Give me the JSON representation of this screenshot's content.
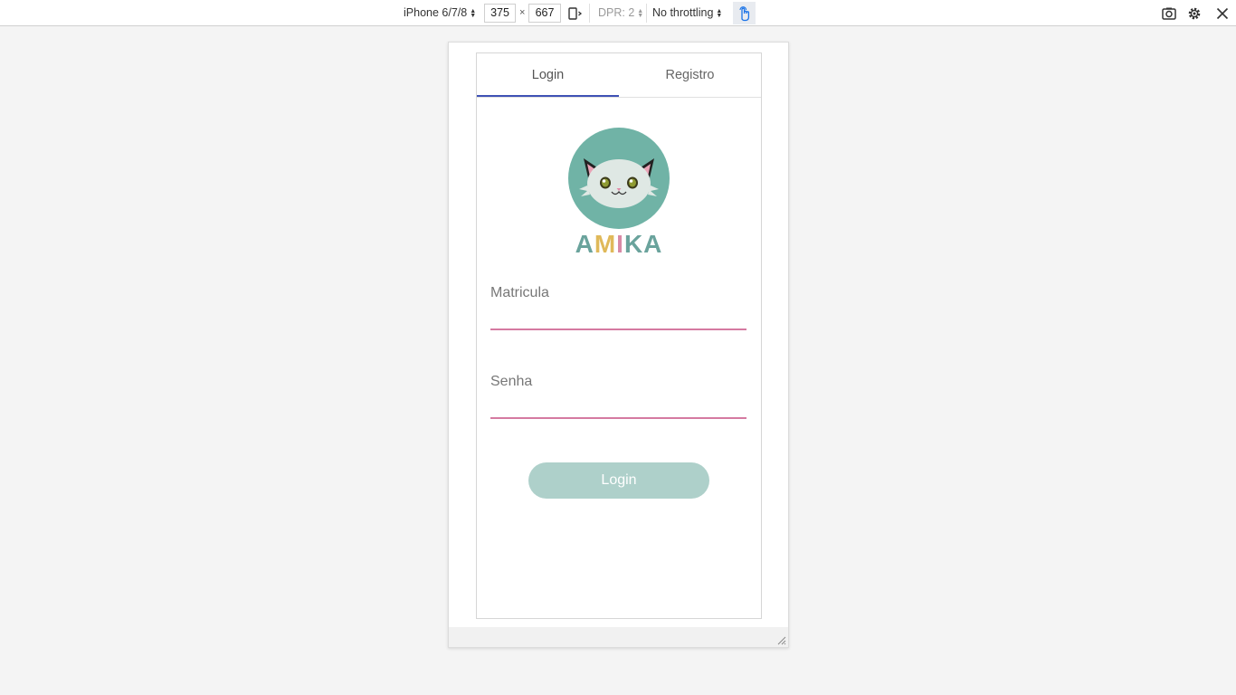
{
  "toolbar": {
    "device": "iPhone 6/7/8",
    "width": "375",
    "times": "×",
    "height": "667",
    "dpr": "DPR: 2",
    "throttling": "No throttling",
    "icons": [
      "rotate-icon",
      "touch-icon",
      "screenshot-icon",
      "settings-icon",
      "close-icon"
    ]
  },
  "app": {
    "tabs": [
      {
        "label": "Login",
        "active": true
      },
      {
        "label": "Registro",
        "active": false
      }
    ],
    "logo": {
      "letters": [
        "A",
        "M",
        "I",
        "K",
        "A"
      ],
      "letter_colors": [
        "#6aa39c",
        "#e0b95a",
        "#d88aa6",
        "#6aa39c",
        "#6aa39c"
      ],
      "circle_color": "#70b3a6"
    },
    "fields": {
      "matricula_label": "Matricula",
      "matricula_value": "",
      "senha_label": "Senha",
      "senha_value": ""
    },
    "login_button": "Login"
  },
  "colors": {
    "tab_indicator": "#3f51b5",
    "field_underline": "#d57aa1",
    "button_bg": "#aed0ca",
    "button_text": "#ffffff"
  }
}
